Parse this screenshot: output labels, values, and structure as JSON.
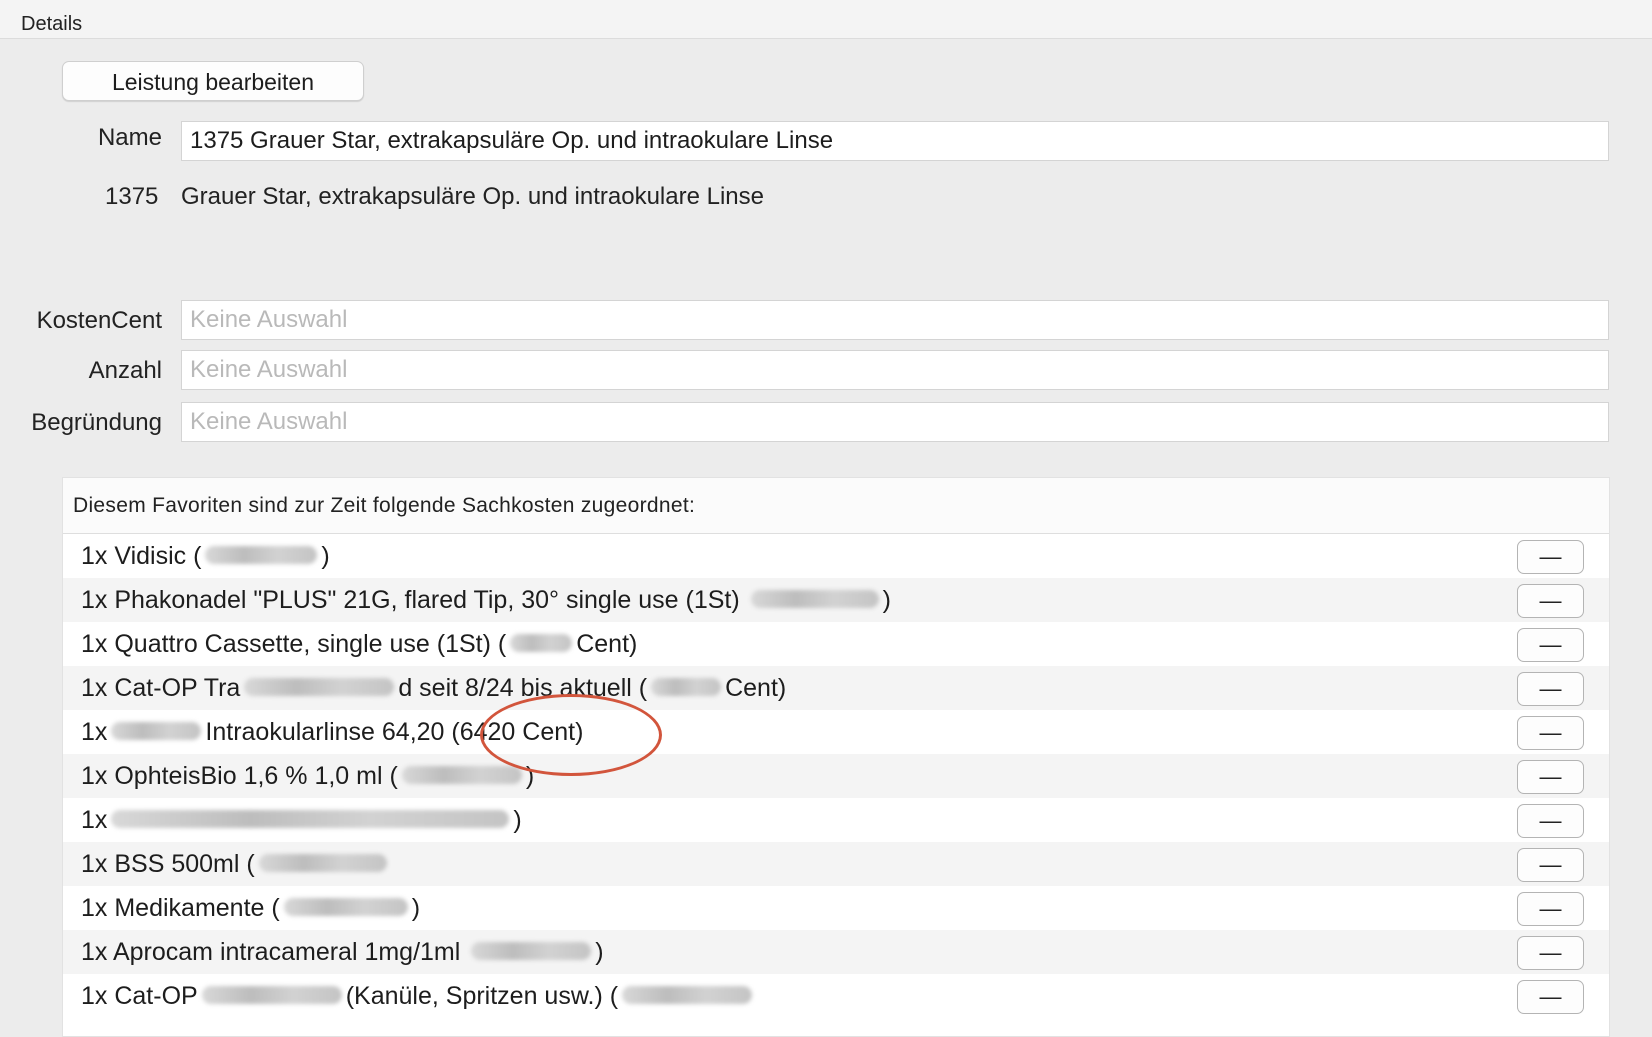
{
  "header": {
    "title": "Details"
  },
  "toolbar": {
    "edit_label": "Leistung bearbeiten"
  },
  "form": {
    "name_label": "Name",
    "name_value": "1375 Grauer Star, extrakapsuläre Op. und intraokulare Linse",
    "code": "1375",
    "description": "Grauer Star, extrakapsuläre Op. und intraokulare Linse",
    "kostencent_label": "KostenCent",
    "anzahl_label": "Anzahl",
    "begruendung_label": "Begründung",
    "placeholder": "Keine Auswahl"
  },
  "costs": {
    "title": "Diesem Favoriten sind zur Zeit folgende Sachkosten zugeordnet:",
    "remove_label": "—",
    "items": [
      {
        "prefix": "1x Vidisic",
        "mid": "(",
        "suffix": ")"
      },
      {
        "prefix": "1x Phakonadel \"PLUS\" 21G, flared Tip, 30° single use (1St)",
        "mid": "",
        "suffix": ")"
      },
      {
        "prefix": "1x Quattro Cassette, single use (1St)",
        "mid": "(",
        "suffix": "Cent)"
      },
      {
        "prefix": "1x Cat-OP Tra",
        "mid": "d seit 8/24 bis aktuell (",
        "suffix": "Cent)"
      },
      {
        "prefix": "1x",
        "mid": "Intraokularlinse 64,20 ",
        "suffix": "(6420 Cent)"
      },
      {
        "prefix": "1x OphteisBio 1,6 % 1,0 ml",
        "mid": "(",
        "suffix": ")"
      },
      {
        "prefix": "1x",
        "mid": "",
        "suffix": ")"
      },
      {
        "prefix": "1x BSS 500ml",
        "mid": "(",
        "suffix": ""
      },
      {
        "prefix": "1x Medikamente",
        "mid": "(",
        "suffix": ")"
      },
      {
        "prefix": "1x Aprocam intracameral 1mg/1ml",
        "mid": "",
        "suffix": ")"
      },
      {
        "prefix": "1x Cat-OP",
        "mid": "(Kanüle, Spritzen usw.) (",
        "suffix": ""
      }
    ]
  }
}
